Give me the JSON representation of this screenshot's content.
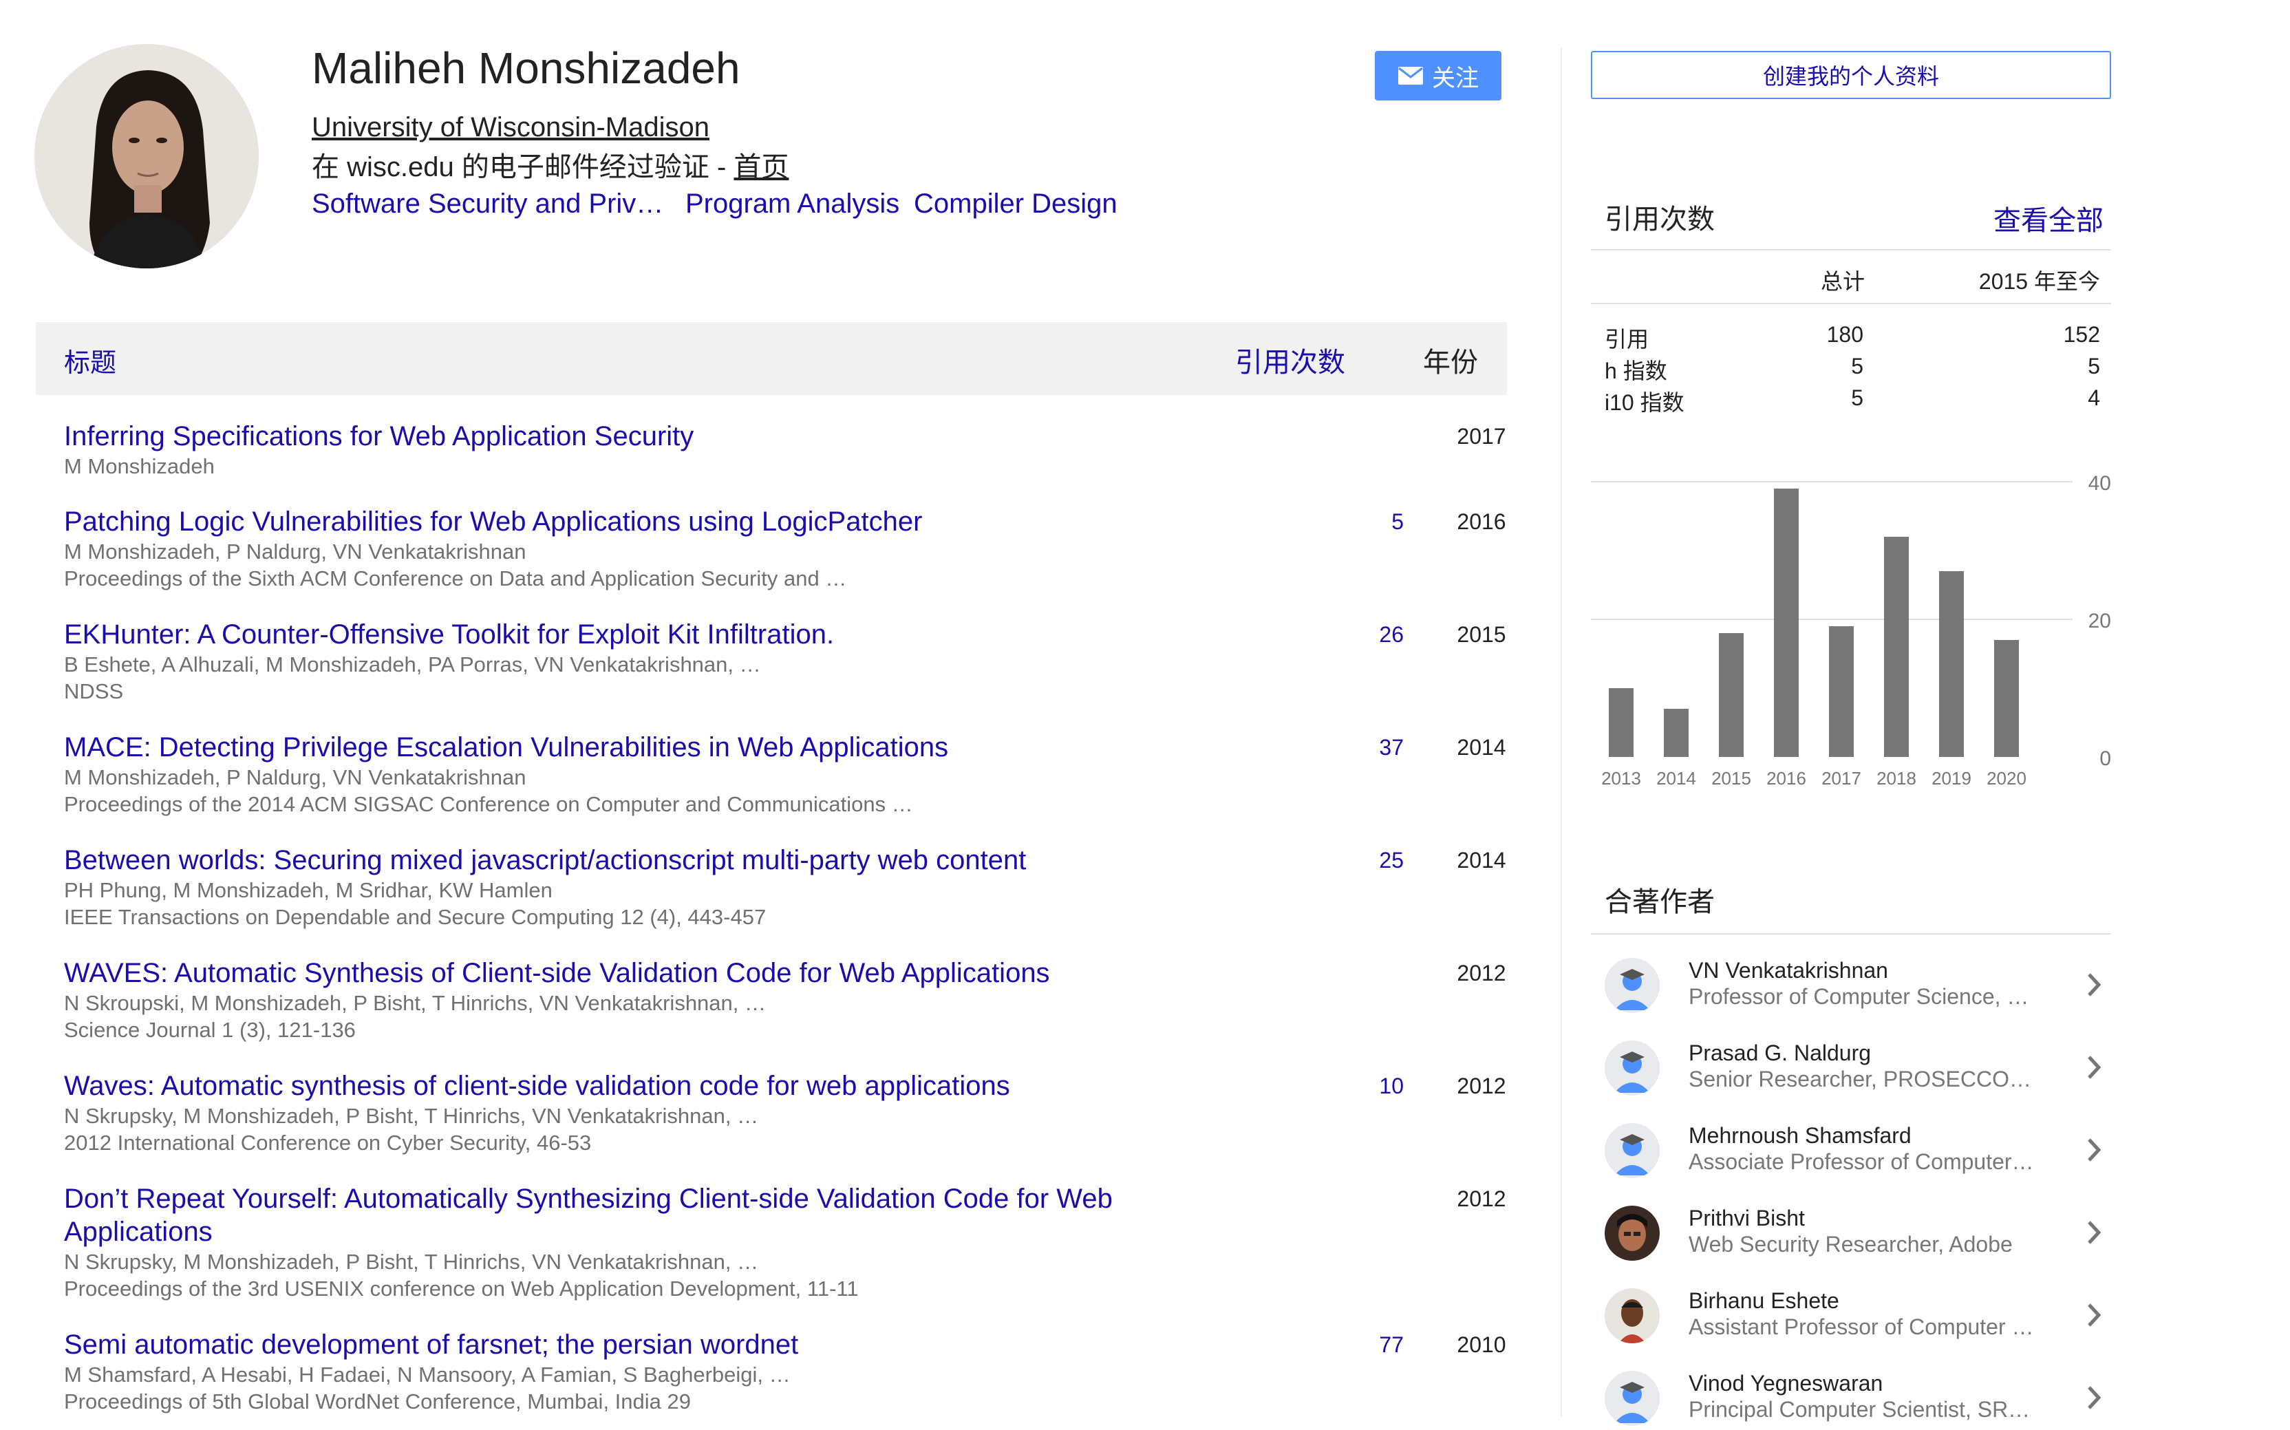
{
  "profile": {
    "name": "Maliheh Monshizadeh",
    "affiliation": "University of Wisconsin-Madison",
    "verified_prefix": "在 wisc.edu 的电子邮件经过验证 - ",
    "homepage_label": "首页",
    "interests": [
      "Software Security and Priv…",
      "Program Analysis",
      "Compiler Design"
    ],
    "follow_label": "关注"
  },
  "create_profile_label": "创建我的个人资料",
  "table": {
    "header_title": "标题",
    "header_cites": "引用次数",
    "header_year": "年份",
    "rows": [
      {
        "title": "Inferring Specifications for Web Application Security",
        "authors": "M Monshizadeh",
        "venue": "",
        "cites": "",
        "year": "2017"
      },
      {
        "title": "Patching Logic Vulnerabilities for Web Applications using LogicPatcher",
        "authors": "M Monshizadeh, P Naldurg, VN Venkatakrishnan",
        "venue": "Proceedings of the Sixth ACM Conference on Data and Application Security and …",
        "cites": "5",
        "year": "2016"
      },
      {
        "title": "EKHunter: A Counter-Offensive Toolkit for Exploit Kit Infiltration.",
        "authors": "B Eshete, A Alhuzali, M Monshizadeh, PA Porras, VN Venkatakrishnan, …",
        "venue": "NDSS",
        "cites": "26",
        "year": "2015"
      },
      {
        "title": "MACE: Detecting Privilege Escalation Vulnerabilities in Web Applications",
        "authors": "M Monshizadeh, P Naldurg, VN Venkatakrishnan",
        "venue": "Proceedings of the 2014 ACM SIGSAC Conference on Computer and Communications …",
        "cites": "37",
        "year": "2014"
      },
      {
        "title": "Between worlds: Securing mixed javascript/actionscript multi-party web content",
        "authors": "PH Phung, M Monshizadeh, M Sridhar, KW Hamlen",
        "venue": "IEEE Transactions on Dependable and Secure Computing 12 (4), 443-457",
        "cites": "25",
        "year": "2014"
      },
      {
        "title": "WAVES: Automatic Synthesis of Client-side Validation Code for Web Applications",
        "authors": "N Skroupski, M Monshizadeh, P Bisht, T Hinrichs, VN Venkatakrishnan, …",
        "venue": "Science Journal 1 (3), 121-136",
        "cites": "",
        "year": "2012"
      },
      {
        "title": "Waves: Automatic synthesis of client-side validation code for web applications",
        "authors": "N Skrupsky, M Monshizadeh, P Bisht, T Hinrichs, VN Venkatakrishnan, …",
        "venue": "2012 International Conference on Cyber Security, 46-53",
        "cites": "10",
        "year": "2012"
      },
      {
        "title": "Don’t Repeat Yourself: Automatically Synthesizing Client-side Validation Code for Web Applications",
        "authors": "N Skrupsky, M Monshizadeh, P Bisht, T Hinrichs, VN Venkatakrishnan, …",
        "venue": "Proceedings of the 3rd USENIX conference on Web Application Development, 11-11",
        "cites": "",
        "year": "2012"
      },
      {
        "title": "Semi automatic development of farsnet; the persian wordnet",
        "authors": "M Shamsfard, A Hesabi, H Fadaei, N Mansoory, A Famian, S Bagherbeigi, …",
        "venue": "Proceedings of 5th Global WordNet Conference, Mumbai, India 29",
        "cites": "77",
        "year": "2010"
      }
    ]
  },
  "citations": {
    "title": "引用次数",
    "view_all": "查看全部",
    "col_total": "总计",
    "col_since": "2015 年至今",
    "stats": [
      {
        "label": "引用",
        "total": "180",
        "since": "152"
      },
      {
        "label": "h 指数",
        "total": "5",
        "since": "5"
      },
      {
        "label": "i10 指数",
        "total": "5",
        "since": "4"
      }
    ]
  },
  "chart_data": {
    "type": "bar",
    "categories": [
      "2013",
      "2014",
      "2015",
      "2016",
      "2017",
      "2018",
      "2019",
      "2020"
    ],
    "values": [
      10,
      7,
      18,
      39,
      19,
      32,
      27,
      17
    ],
    "ylim": [
      0,
      40
    ],
    "yticks": [
      "40",
      "20",
      "0"
    ],
    "bar_color": "#777777",
    "grid": true
  },
  "coauthors": {
    "title": "合著作者",
    "items": [
      {
        "name": "VN Venkatakrishnan",
        "affiliation": "Professor of Computer Science, …",
        "avatar": "placeholder"
      },
      {
        "name": "Prasad G. Naldurg",
        "affiliation": "Senior Researcher, PROSECCO…",
        "avatar": "placeholder"
      },
      {
        "name": "Mehrnoush Shamsfard",
        "affiliation": "Associate Professor of Computer…",
        "avatar": "placeholder"
      },
      {
        "name": "Prithvi Bisht",
        "affiliation": "Web Security Researcher, Adobe",
        "avatar": "photo"
      },
      {
        "name": "Birhanu Eshete",
        "affiliation": "Assistant Professor of Computer …",
        "avatar": "photo"
      },
      {
        "name": "Vinod Yegneswaran",
        "affiliation": "Principal Computer Scientist, SR…",
        "avatar": "placeholder"
      }
    ]
  },
  "colors": {
    "link": "#1a0dab",
    "follow_button": "#4d90fe",
    "bar": "#777777"
  }
}
